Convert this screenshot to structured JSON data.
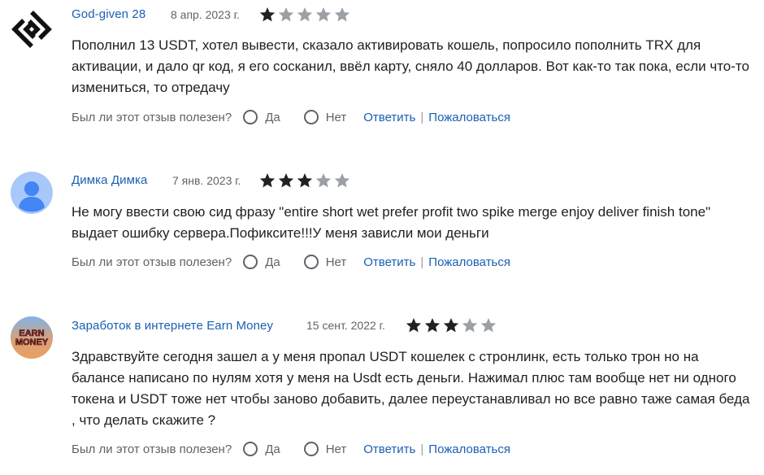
{
  "colors": {
    "star_filled": "#202124",
    "star_empty": "#9aa0a6",
    "link": "#1a5fb4"
  },
  "reviews": [
    {
      "author": "God-given 28",
      "avatar_icon": "diamond-logo-icon",
      "date": "8 апр. 2023 г.",
      "rating": 1,
      "text": "Пополнил 13 USDT, хотел вывести, сказало активировать кошель, попросило пополнить TRX для активации, и дало qr код, я его сосканил, ввёл карту, сняло 40 долларов. Вот как-то так пока, если что-то измениться, то отредачу",
      "helpful_question": "Был ли этот отзыв полезен?",
      "yes_label": "Да",
      "no_label": "Нет",
      "reply_label": "Ответить",
      "separator": "|",
      "report_label": "Пожаловаться"
    },
    {
      "author": "Димка Димка",
      "avatar_icon": "default-user-icon",
      "date": "7 янв. 2023 г.",
      "rating": 3,
      "text": "Не могу ввести свою сид фразу \"entire short wet prefer profit two spike merge enjoy deliver finish tone\" выдает ошибку сервера.Пофиксите!!!У меня зависли мои деньги",
      "helpful_question": "Был ли этот отзыв полезен?",
      "yes_label": "Да",
      "no_label": "Нет",
      "reply_label": "Ответить",
      "separator": "|",
      "report_label": "Пожаловаться"
    },
    {
      "author": "Заработок в интернете Earn Money",
      "avatar_icon": "earn-money-logo-icon",
      "avatar_text": "EARN MONEY",
      "date": "15 сент. 2022 г.",
      "rating": 3,
      "text": "Здравствуйте сегодня зашел а у меня пропал USDT кошелек с стронлинк, есть только трон но на балансе написано по нулям хотя у меня на Usdt есть деньги. Нажимал плюс там вообще нет ни одного токена и USDT тоже нет чтобы заново добавить, далее переустанавливал но все равно таже самая беда , что делать скажите ?",
      "helpful_question": "Был ли этот отзыв полезен?",
      "yes_label": "Да",
      "no_label": "Нет",
      "reply_label": "Ответить",
      "separator": "|",
      "report_label": "Пожаловаться"
    }
  ]
}
